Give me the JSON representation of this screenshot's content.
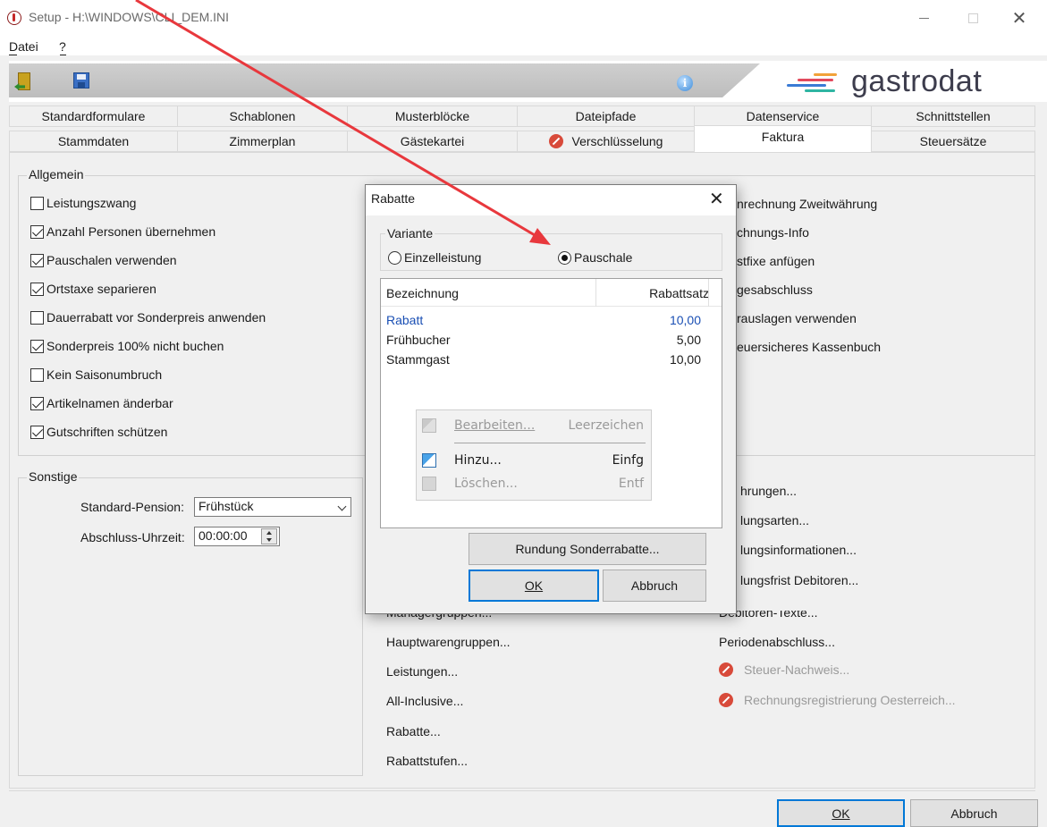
{
  "window": {
    "title": "Setup - H:\\WINDOWS\\CLI_DEM.INI"
  },
  "menu": [
    "Datei",
    "?"
  ],
  "logo": {
    "text": "gastrodat"
  },
  "tabs_row1": [
    "Standardformulare",
    "Schablonen",
    "Musterblöcke",
    "Dateipfade",
    "Datenservice",
    "Schnittstellen"
  ],
  "tabs_row2": [
    "Stammdaten",
    "Zimmerplan",
    "Gästekartei",
    "Verschlüsselung",
    "Faktura",
    "Steuersätze"
  ],
  "active_tab": "Faktura",
  "allgemein": {
    "title": "Allgemein",
    "checkboxes": [
      {
        "label": "Leistungszwang",
        "checked": false
      },
      {
        "label": "Anzahl Personen übernehmen",
        "checked": true
      },
      {
        "label": "Pauschalen verwenden",
        "checked": true
      },
      {
        "label": "Ortstaxe separieren",
        "checked": true
      },
      {
        "label": "Dauerrabatt vor Sonderpreis anwenden",
        "checked": false
      },
      {
        "label": "Sonderpreis 100% nicht buchen",
        "checked": true
      },
      {
        "label": "Kein Saisonumbruch",
        "checked": false
      },
      {
        "label": "Artikelnamen änderbar",
        "checked": true
      },
      {
        "label": "Gutschriften schützen",
        "checked": true
      }
    ],
    "right_items": [
      "nrechnung Zweitwährung",
      "chnungs-Info",
      "stfixe anfügen",
      "gesabschluss",
      "rauslagen verwenden",
      "euersicheres Kassenbuch"
    ]
  },
  "sonstige": {
    "title": "Sonstige",
    "pension_label": "Standard-Pension:",
    "pension_value": "Frühstück",
    "time_label": "Abschluss-Uhrzeit:",
    "time_value": "00:00:00",
    "middle_links": [
      "Managergruppen...",
      "Hauptwarengruppen...",
      "Leistungen...",
      "All-Inclusive...",
      "Rabatte...",
      "Rabattstufen..."
    ],
    "right_links": [
      "hrungen...",
      "lungsarten...",
      "lungsinformationen...",
      "lungsfrist Debitoren...",
      "Debitoren-Texte...",
      "Periodenabschluss..."
    ],
    "disabled_links": [
      "Steuer-Nachweis...",
      "Rechnungsregistrierung Oesterreich..."
    ]
  },
  "footer": {
    "ok": "OK",
    "cancel": "Abbruch"
  },
  "dialog": {
    "title": "Rabatte",
    "variant_title": "Variante",
    "radio_einzel": "Einzelleistung",
    "radio_pauschale": "Pauschale",
    "selected_variant": "Pauschale",
    "columns": [
      "Bezeichnung",
      "Rabattsatz"
    ],
    "rows": [
      {
        "name": "Rabatt",
        "rate": "10,00",
        "highlight": true
      },
      {
        "name": "Frühbucher",
        "rate": "5,00",
        "highlight": false
      },
      {
        "name": "Stammgast",
        "rate": "10,00",
        "highlight": false
      }
    ],
    "context_menu": [
      {
        "label": "Bearbeiten...",
        "shortcut": "Leerzeichen",
        "enabled": false
      },
      {
        "label": "Hinzu...",
        "shortcut": "Einfg",
        "enabled": true
      },
      {
        "label": "Löschen...",
        "shortcut": "Entf",
        "enabled": false
      }
    ],
    "rounding_button": "Rundung Sonderrabatte...",
    "ok": "OK",
    "cancel": "Abbruch"
  },
  "colors": {
    "accent": "#0078d7",
    "highlight_text": "#1a4fb4",
    "annotation_arrow": "#e8383d"
  }
}
